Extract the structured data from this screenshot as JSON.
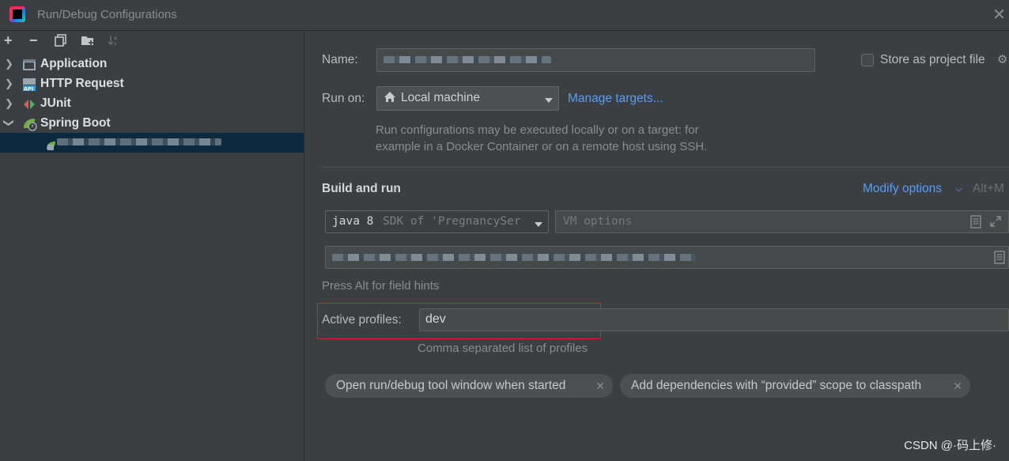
{
  "window": {
    "title": "Run/Debug Configurations",
    "close_glyph": "✕"
  },
  "toolbar": {
    "add": "+",
    "remove": "−",
    "copy_icon": "copy-icon",
    "folder_icon": "new-folder-icon",
    "sort_icon": "sort-icon"
  },
  "tree": {
    "items": [
      {
        "label": "Application",
        "icon": "application-icon"
      },
      {
        "label": "HTTP Request",
        "icon": "http-request-icon"
      },
      {
        "label": "JUnit",
        "icon": "junit-icon"
      },
      {
        "label": "Spring Boot",
        "icon": "spring-boot-icon",
        "expanded": true
      }
    ]
  },
  "config": {
    "name_label": "Name:",
    "store_label": "Store as project file",
    "run_on_label": "Run on:",
    "run_on_value": "Local machine",
    "manage_targets": "Manage targets...",
    "run_on_hint_1": "Run configurations may be executed locally or on a target: for",
    "run_on_hint_2": "example in a Docker Container or on a remote host using SSH.",
    "build_and_run": "Build and run",
    "modify_options": "Modify options",
    "modify_shortcut": "Alt+M",
    "sdk_name": "java 8",
    "sdk_detail": "SDK of 'PregnancySer",
    "vm_options_placeholder": "VM options",
    "field_hints": "Press Alt for field hints",
    "active_profiles_label": "Active profiles:",
    "active_profiles_value": "dev",
    "profiles_hint": "Comma separated list of profiles",
    "chips": [
      "Open run/debug tool window when started",
      "Add dependencies with “provided” scope to classpath"
    ]
  },
  "watermark": "CSDN @·码上修·",
  "colors": {
    "background": "#3c3f41",
    "selection": "#0d293e",
    "link": "#589df6",
    "highlight": "#d32424"
  }
}
